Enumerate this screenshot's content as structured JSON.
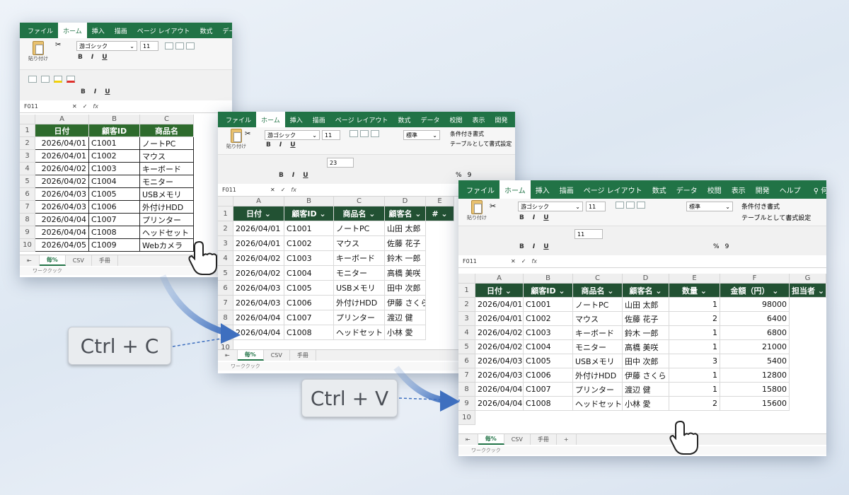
{
  "tabs": [
    "ファイル",
    "ホーム",
    "挿入",
    "描画",
    "ページ レイアウト",
    "数式",
    "データ",
    "校閲",
    "表示",
    "開発",
    "ヘルプ"
  ],
  "tell_me": "何をしますか",
  "ribbon": {
    "paste_label": "貼り付け",
    "font_name": "游ゴシック",
    "font_size": "11",
    "font_size_b": "23",
    "number_format": "標準",
    "conditional": "条件付き書式",
    "table_format": "テーブルとして書式設定",
    "bold": "B",
    "italic": "I",
    "underline": "U",
    "percent": "%",
    "comma": "9"
  },
  "formula_bar": {
    "cell_ref": "F011",
    "fx": "fx"
  },
  "columns": [
    "A",
    "B",
    "C",
    "D",
    "E",
    "F",
    "G"
  ],
  "sheet_tabs": [
    "毎%",
    "CSV",
    "手冊"
  ],
  "status_text": "ワーククック",
  "win1": {
    "headers": [
      "日付",
      "顧客ID",
      "商品名"
    ],
    "rows": [
      [
        "2026/04/01",
        "C1001",
        "ノートPC"
      ],
      [
        "2026/04/01",
        "C1002",
        "マウス"
      ],
      [
        "2026/04/02",
        "C1003",
        "キーボード"
      ],
      [
        "2026/04/02",
        "C1004",
        "モニター"
      ],
      [
        "2026/04/03",
        "C1005",
        "USBメモリ"
      ],
      [
        "2026/04/03",
        "C1006",
        "外付けHDD"
      ],
      [
        "2026/04/04",
        "C1007",
        "プリンター"
      ],
      [
        "2026/04/04",
        "C1008",
        "ヘッドセット"
      ],
      [
        "2026/04/05",
        "C1009",
        "Webカメラ"
      ]
    ]
  },
  "win2": {
    "headers": [
      "日付",
      "顧客ID",
      "商品名",
      "顧客名",
      "#"
    ],
    "rows": [
      [
        "2026/04/01",
        "C1001",
        "ノートPC",
        "山田 太郎"
      ],
      [
        "2026/04/01",
        "C1002",
        "マウス",
        "佐藤 花子"
      ],
      [
        "2026/04/02",
        "C1003",
        "キーボード",
        "鈴木 一郎"
      ],
      [
        "2026/04/02",
        "C1004",
        "モニター",
        "高橋 美咲"
      ],
      [
        "2026/04/03",
        "C1005",
        "USBメモリ",
        "田中 次郎"
      ],
      [
        "2026/04/03",
        "C1006",
        "外付けHDD",
        "伊藤 さくら"
      ],
      [
        "2026/04/04",
        "C1007",
        "プリンター",
        "渡辺 健"
      ],
      [
        "2026/04/04",
        "C1008",
        "ヘッドセット",
        "小林 愛"
      ]
    ]
  },
  "win3": {
    "headers": [
      "日付",
      "顧客ID",
      "商品名",
      "顧客名",
      "数量",
      "金額（円）",
      "担当者"
    ],
    "rows": [
      [
        "2026/04/01",
        "C1001",
        "ノートPC",
        "山田 太郎",
        "1",
        "98000"
      ],
      [
        "2026/04/01",
        "C1002",
        "マウス",
        "佐藤 花子",
        "2",
        "6400"
      ],
      [
        "2026/04/02",
        "C1003",
        "キーボード",
        "鈴木 一郎",
        "1",
        "6800"
      ],
      [
        "2026/04/02",
        "C1004",
        "モニター",
        "高橋 美咲",
        "1",
        "21000"
      ],
      [
        "2026/04/03",
        "C1005",
        "USBメモリ",
        "田中 次郎",
        "3",
        "5400"
      ],
      [
        "2026/04/03",
        "C1006",
        "外付けHDD",
        "伊藤 さくら",
        "1",
        "12800"
      ],
      [
        "2026/04/04",
        "C1007",
        "プリンター",
        "渡辺 健",
        "1",
        "15800"
      ],
      [
        "2026/04/04",
        "C1008",
        "ヘッドセット",
        "小林 愛",
        "2",
        "15600"
      ]
    ]
  },
  "shortcuts": {
    "copy": "Ctrl + C",
    "paste": "Ctrl + V"
  }
}
